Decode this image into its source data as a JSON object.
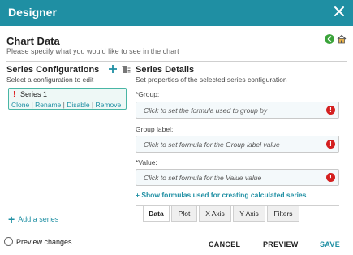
{
  "window": {
    "title": "Designer"
  },
  "header": {
    "title": "Chart Data",
    "subtitle": "Please specify what you would like to see in the chart"
  },
  "left": {
    "title": "Series Configurations",
    "subtitle": "Select a configuration to edit",
    "series": [
      {
        "name": "Series 1",
        "actions": [
          "Clone",
          "Rename",
          "Disable",
          "Remove"
        ]
      }
    ],
    "add_series": "Add a series"
  },
  "right": {
    "title": "Series Details",
    "subtitle": "Set properties of the selected series configuration",
    "fields": [
      {
        "label": "*Group:",
        "placeholder": "Click to set the formula used to group by"
      },
      {
        "label": "Group label:",
        "placeholder": "Click to set formula for the Group label value"
      },
      {
        "label": "*Value:",
        "placeholder": "Click to set formula for the Value value"
      }
    ],
    "show_formulas": "+ Show formulas used for creating calculated series",
    "tabs": [
      "Data",
      "Plot",
      "X Axis",
      "Y Axis",
      "Filters"
    ],
    "active_tab": "Data"
  },
  "footer": {
    "preview_changes": "Preview changes",
    "cancel": "CANCEL",
    "preview": "PREVIEW",
    "save": "SAVE"
  },
  "colors": {
    "accent": "#1f8fa3",
    "error": "#d42020",
    "back_icon": "#3aa33a"
  }
}
